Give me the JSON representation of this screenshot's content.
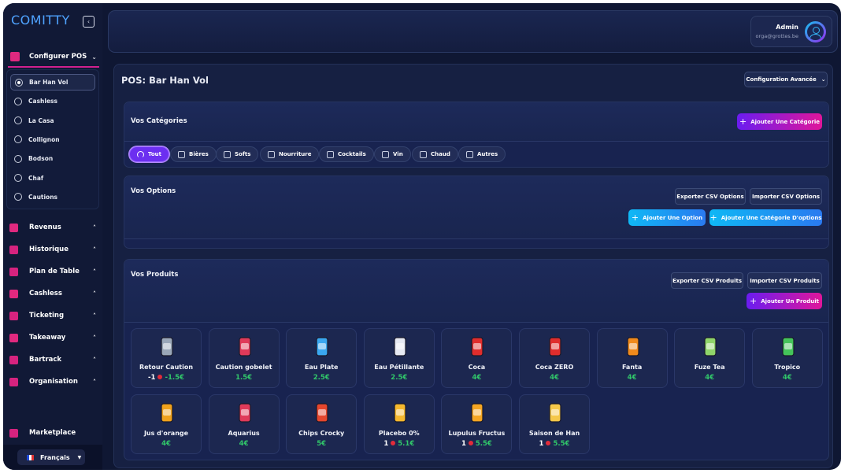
{
  "app": {
    "brand": "COMITTY"
  },
  "sidebar": {
    "section_label": "Configurer POS",
    "pos_list": [
      {
        "label": "Bar Han Vol",
        "active": true
      },
      {
        "label": "Cashless",
        "active": false
      },
      {
        "label": "La Casa",
        "active": false
      },
      {
        "label": "Collignon",
        "active": false
      },
      {
        "label": "Bodson",
        "active": false
      },
      {
        "label": "Chaf",
        "active": false
      },
      {
        "label": "Cautions",
        "active": false
      }
    ],
    "nav": [
      {
        "label": "Revenus",
        "icon": "revenue-icon"
      },
      {
        "label": "Historique",
        "icon": "history-icon"
      },
      {
        "label": "Plan de Table",
        "icon": "table-plan-icon"
      },
      {
        "label": "Cashless",
        "icon": "card-icon"
      },
      {
        "label": "Ticketing",
        "icon": "ticket-icon"
      },
      {
        "label": "Takeaway",
        "icon": "takeaway-icon"
      },
      {
        "label": "Bartrack",
        "icon": "glass-icon"
      },
      {
        "label": "Organisation",
        "icon": "organisation-icon"
      }
    ],
    "marketplace": "Marketplace",
    "language": "Français"
  },
  "header": {
    "user_name": "Admin",
    "user_email": "orga@grottes.be"
  },
  "main": {
    "title": "POS: Bar Han Vol",
    "config_button": "Configuration Avancée",
    "categories": {
      "title": "Vos Catégories",
      "add_button": "Ajouter Une Catégorie",
      "chips": [
        {
          "label": "Tout",
          "active": true
        },
        {
          "label": "Bières",
          "active": false
        },
        {
          "label": "Softs",
          "active": false
        },
        {
          "label": "Nourriture",
          "active": false
        },
        {
          "label": "Cocktails",
          "active": false
        },
        {
          "label": "Vin",
          "active": false
        },
        {
          "label": "Chaud",
          "active": false
        },
        {
          "label": "Autres",
          "active": false
        }
      ]
    },
    "options": {
      "title": "Vos Options",
      "export_button": "Exporter CSV Options",
      "import_button": "Importer CSV Options",
      "add_option_button": "Ajouter Une Option",
      "add_option_category_button": "Ajouter Une Catégorie D'options"
    },
    "products": {
      "title": "Vos Produits",
      "export_button": "Exporter CSV Produits",
      "import_button": "Importer CSV Produits",
      "add_button": "Ajouter Un Produit",
      "items": [
        {
          "name": "Retour Caution",
          "qty": "-1",
          "price": "-1.5€",
          "icon": "beer-mug-icon",
          "color": "#9aa7b8"
        },
        {
          "name": "Caution gobelet",
          "qty": "",
          "price": "1.5€",
          "icon": "cups-icon",
          "color": "#e03a5a"
        },
        {
          "name": "Eau Plate",
          "qty": "",
          "price": "2.5€",
          "icon": "water-bottle-icon",
          "color": "#3aa7f0"
        },
        {
          "name": "Eau Pétillante",
          "qty": "",
          "price": "2.5€",
          "icon": "sparkling-water-icon",
          "color": "#e6e9f2"
        },
        {
          "name": "Coca",
          "qty": "",
          "price": "4€",
          "icon": "cola-can-icon",
          "color": "#e02d2d"
        },
        {
          "name": "Coca ZERO",
          "qty": "",
          "price": "4€",
          "icon": "cola-zero-can-icon",
          "color": "#e02d2d"
        },
        {
          "name": "Fanta",
          "qty": "",
          "price": "4€",
          "icon": "fanta-can-icon",
          "color": "#f08a1c"
        },
        {
          "name": "Fuze Tea",
          "qty": "",
          "price": "4€",
          "icon": "tea-can-icon",
          "color": "#8fd46a"
        },
        {
          "name": "Tropico",
          "qty": "",
          "price": "4€",
          "icon": "tropico-can-icon",
          "color": "#44c45a"
        },
        {
          "name": "Jus d'orange",
          "qty": "",
          "price": "4€",
          "icon": "orange-juice-icon",
          "color": "#f0a21c"
        },
        {
          "name": "Aquarius",
          "qty": "",
          "price": "4€",
          "icon": "cups-icon",
          "color": "#e03a5a"
        },
        {
          "name": "Chips Crocky",
          "qty": "",
          "price": "5€",
          "icon": "chips-bag-icon",
          "color": "#e6462d"
        },
        {
          "name": "Placebo 0%",
          "qty": "1",
          "price": "5.1€",
          "icon": "beer-glass-icon",
          "color": "#f5b82e"
        },
        {
          "name": "Lupulus Fructus",
          "qty": "1",
          "price": "5.5€",
          "icon": "beer-glass-icon",
          "color": "#f5a623"
        },
        {
          "name": "Saison de Han",
          "qty": "1",
          "price": "5.5€",
          "icon": "beer-tulip-icon",
          "color": "#f5c84a"
        }
      ]
    }
  }
}
